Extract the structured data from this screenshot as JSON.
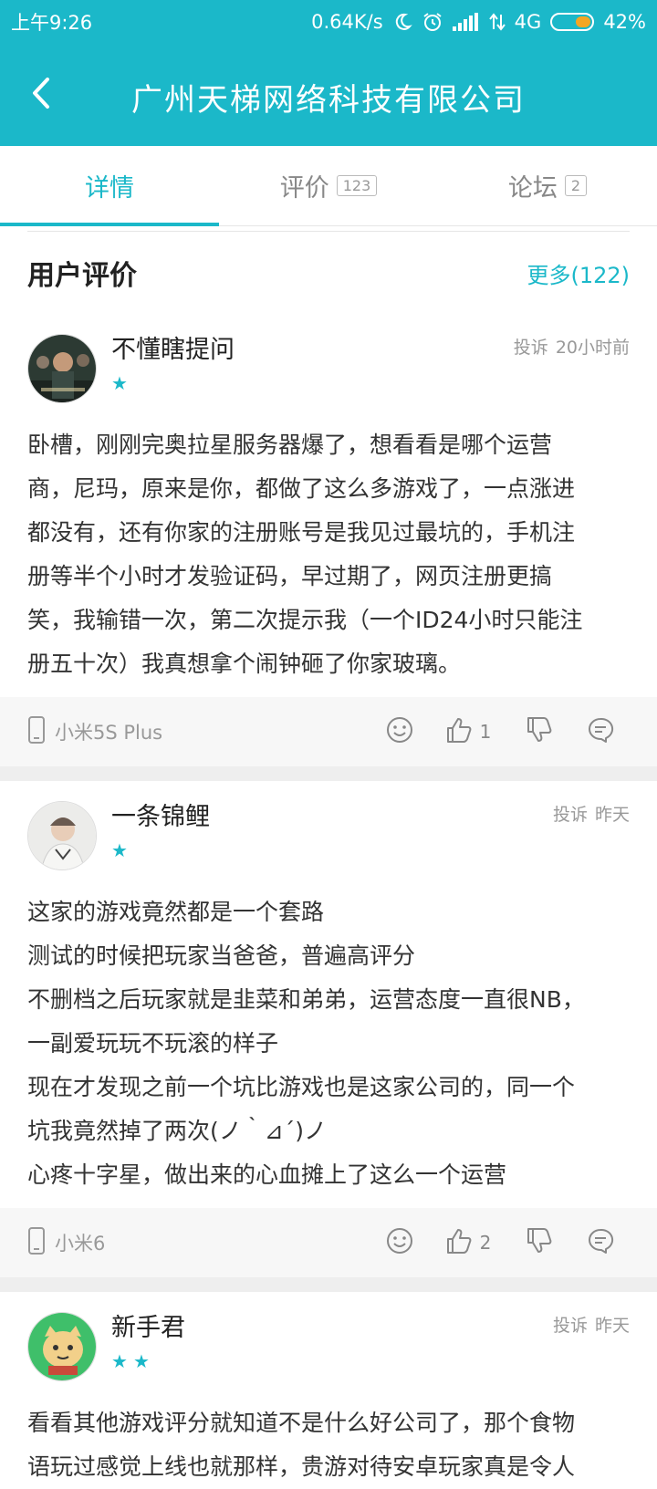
{
  "status_bar": {
    "time": "上午9:26",
    "net_speed": "0.64K/s",
    "network": "4G",
    "battery": "42%",
    "battery_level": 0.42
  },
  "header": {
    "title": "广州天梯网络科技有限公司",
    "back_icon": "chevron-left-icon"
  },
  "tabs": [
    {
      "label": "详情",
      "badge": null,
      "active": true
    },
    {
      "label": "评价",
      "badge": "123",
      "active": false
    },
    {
      "label": "论坛",
      "badge": "2",
      "active": false
    }
  ],
  "section": {
    "title": "用户评价",
    "more": "更多(122)"
  },
  "reviews": [
    {
      "user": "不懂瞎提问",
      "stars": 1,
      "report": "投诉",
      "time": "20小时前",
      "lines": [
        "卧槽，刚刚完奥拉星服务器爆了，想看看是哪个运营",
        "商，尼玛，原来是你，都做了这么多游戏了，一点涨进",
        "都没有，还有你家的注册账号是我见过最坑的，手机注",
        "册等半个小时才发验证码，早过期了，网页注册更搞",
        "笑，我输错一次，第二次提示我（一个ID24小时只能注",
        "册五十次）我真想拿个闹钟砸了你家玻璃。"
      ],
      "device": "小米5S Plus",
      "likes": "1"
    },
    {
      "user": "一条锦鲤",
      "stars": 1,
      "report": "投诉",
      "time": "昨天",
      "lines": [
        "这家的游戏竟然都是一个套路",
        "测试的时候把玩家当爸爸，普遍高评分",
        "不删档之后玩家就是韭菜和弟弟，运营态度一直很NB，",
        "一副爱玩玩不玩滚的样子",
        "现在才发现之前一个坑比游戏也是这家公司的，同一个",
        "坑我竟然掉了两次(ノ｀⊿´)ノ",
        "心疼十字星，做出来的心血摊上了这么一个运营"
      ],
      "device": "小米6",
      "likes": "2"
    },
    {
      "user": "新手君",
      "stars": 2,
      "report": "投诉",
      "time": "昨天",
      "lines": [
        "看看其他游戏评分就知道不是什么好公司了，那个食物",
        "语玩过感觉上线也就那样，贵游对待安卓玩家真是令人"
      ],
      "device": "",
      "likes": ""
    }
  ],
  "colors": {
    "accent": "#1bb8c9",
    "battery": "#f5a623"
  }
}
